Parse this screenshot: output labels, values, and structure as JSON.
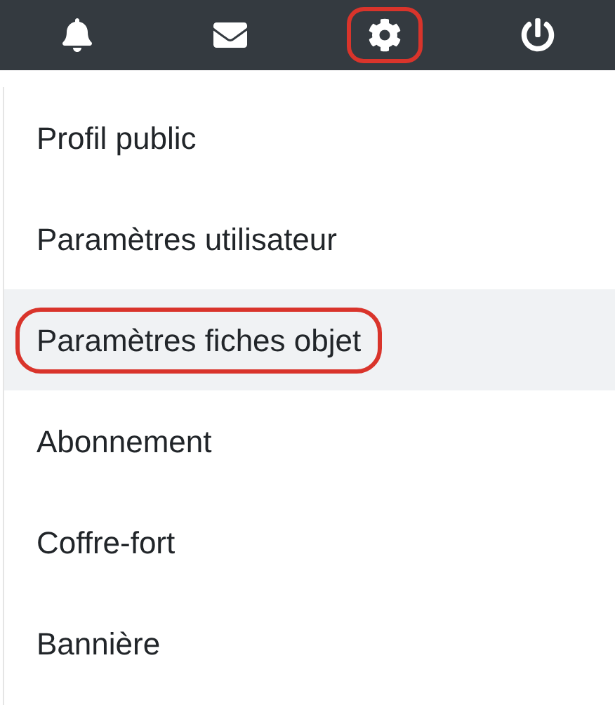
{
  "top_bar": {
    "icons": [
      {
        "kind": "bell",
        "circled": false
      },
      {
        "kind": "envelope",
        "circled": false
      },
      {
        "kind": "gear",
        "circled": true
      },
      {
        "kind": "power",
        "circled": false
      }
    ]
  },
  "menu": {
    "items": [
      {
        "label": "Profil public",
        "highlighted": false,
        "circled": false
      },
      {
        "label": "Paramètres utilisateur",
        "highlighted": false,
        "circled": false
      },
      {
        "label": "Paramètres fiches objet",
        "highlighted": true,
        "circled": true
      },
      {
        "label": "Abonnement",
        "highlighted": false,
        "circled": false
      },
      {
        "label": "Coffre-fort",
        "highlighted": false,
        "circled": false
      },
      {
        "label": "Bannière",
        "highlighted": false,
        "circled": false
      }
    ]
  }
}
